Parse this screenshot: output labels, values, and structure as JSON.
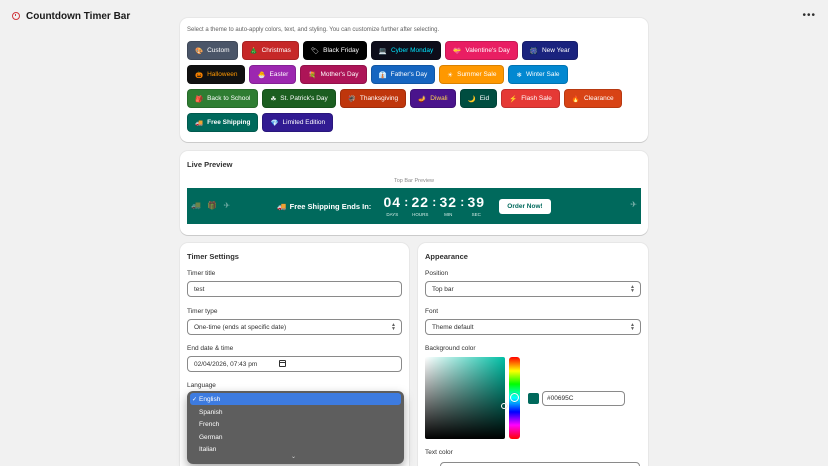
{
  "app": {
    "title": "Countdown Timer Bar",
    "more_label": "•••"
  },
  "themes": {
    "hint": "Select a theme to auto-apply colors, text, and styling. You can customize further after selecting.",
    "items": [
      {
        "icon": "🎨",
        "label": "Custom",
        "bg": "#4a5568",
        "fg": "#ffffff"
      },
      {
        "icon": "🎄",
        "label": "Christmas",
        "bg": "#c62828",
        "fg": "#ffffff"
      },
      {
        "icon": "🏷",
        "label": "Black Friday",
        "bg": "#000000",
        "fg": "#ffffff"
      },
      {
        "icon": "💻",
        "label": "Cyber Monday",
        "bg": "#0d0d1a",
        "fg": "#00e5ff"
      },
      {
        "icon": "💝",
        "label": "Valentine's Day",
        "bg": "#e91e63",
        "fg": "#ffffff"
      },
      {
        "icon": "🎆",
        "label": "New Year",
        "bg": "#1a237e",
        "fg": "#ffffff"
      },
      {
        "icon": "🎃",
        "label": "Halloween",
        "bg": "#111111",
        "fg": "#ff9800"
      },
      {
        "icon": "🐣",
        "label": "Easter",
        "bg": "#9c27b0",
        "fg": "#ffffff"
      },
      {
        "icon": "💐",
        "label": "Mother's Day",
        "bg": "#ad1457",
        "fg": "#ffffff"
      },
      {
        "icon": "👔",
        "label": "Father's Day",
        "bg": "#1565c0",
        "fg": "#ffffff"
      },
      {
        "icon": "☀",
        "label": "Summer Sale",
        "bg": "#ff9800",
        "fg": "#ffffff"
      },
      {
        "icon": "❄",
        "label": "Winter Sale",
        "bg": "#0288d1",
        "fg": "#ffffff"
      },
      {
        "icon": "🎒",
        "label": "Back to School",
        "bg": "#2e7d32",
        "fg": "#ffffff"
      },
      {
        "icon": "☘",
        "label": "St. Patrick's Day",
        "bg": "#1b5e20",
        "fg": "#ffffff"
      },
      {
        "icon": "🦃",
        "label": "Thanksgiving",
        "bg": "#bf360c",
        "fg": "#ffffff"
      },
      {
        "icon": "🪔",
        "label": "Diwali",
        "bg": "#4a148c",
        "fg": "#ffd54f"
      },
      {
        "icon": "🌙",
        "label": "Eid",
        "bg": "#004d40",
        "fg": "#ffffff"
      },
      {
        "icon": "⚡",
        "label": "Flash Sale",
        "bg": "#e53935",
        "fg": "#ffffff"
      },
      {
        "icon": "🔥",
        "label": "Clearance",
        "bg": "#d84315",
        "fg": "#ffffff"
      },
      {
        "icon": "🚚",
        "label": "Free Shipping",
        "bg": "#00695c",
        "fg": "#ffffff"
      },
      {
        "icon": "💎",
        "label": "Limited Edition",
        "bg": "#311b92",
        "fg": "#ffffff"
      }
    ]
  },
  "preview": {
    "title": "Live Preview",
    "subtitle": "Top Bar Preview",
    "message": "Free Shipping Ends In:",
    "message_icon": "🚚",
    "bg_color": "#00695c",
    "countdown": [
      {
        "value": "04",
        "label": "DAYS"
      },
      {
        "value": "22",
        "label": "HOURS"
      },
      {
        "value": "32",
        "label": "MIN"
      },
      {
        "value": "39",
        "label": "SEC"
      }
    ],
    "cta_label": "Order Now!",
    "deco_left": "🚚 🎁 ✈",
    "deco_right": "✈"
  },
  "timer_settings": {
    "title": "Timer Settings",
    "timer_title_label": "Timer title",
    "timer_title_value": "test",
    "timer_type_label": "Timer type",
    "timer_type_value": "One-time (ends at specific date)",
    "end_label": "End date & time",
    "end_value": "02/04/2026, 07:43 pm",
    "language_label": "Language",
    "language_options": [
      "English",
      "Spanish",
      "French",
      "German",
      "Italian"
    ],
    "language_selected": "English"
  },
  "appearance": {
    "title": "Appearance",
    "position_label": "Position",
    "position_value": "Top bar",
    "font_label": "Font",
    "font_value": "Theme default",
    "bg_label": "Background color",
    "bg_hex": "#00695C",
    "text_color_label": "Text color"
  }
}
